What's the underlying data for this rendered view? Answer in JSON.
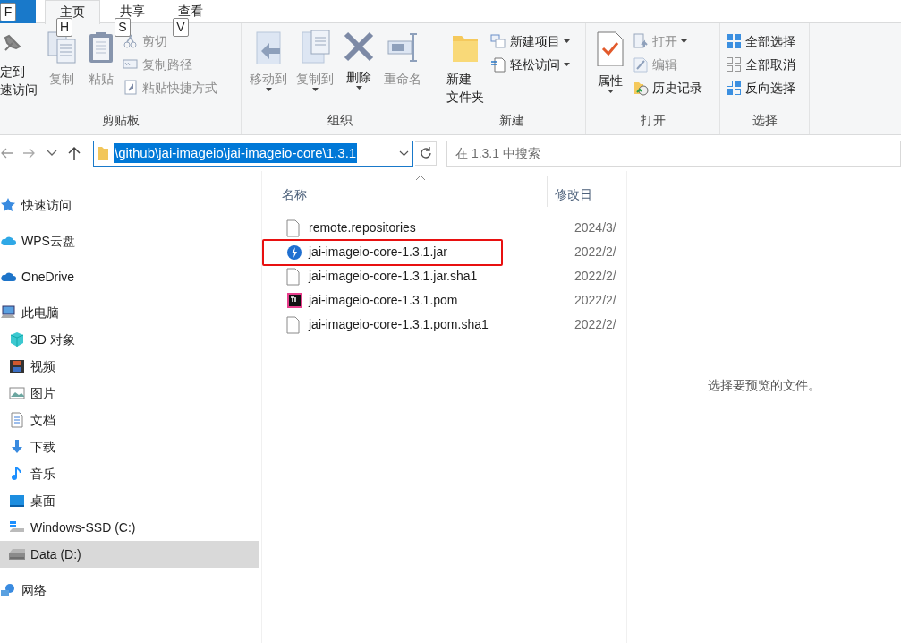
{
  "ribbon_tabs": [
    {
      "kind": "file",
      "keytip": "F",
      "selected": false
    },
    {
      "kind": "tab",
      "label": "主页",
      "keytip": "H",
      "selected": true
    },
    {
      "kind": "tab",
      "label": "共享",
      "keytip": "S",
      "selected": false
    },
    {
      "kind": "tab",
      "label": "查看",
      "keytip": "V",
      "selected": false
    }
  ],
  "ribbon_groups": [
    {
      "label": "剪贴板",
      "items": [
        {
          "kind": "large",
          "lines": [
            "定到",
            "速访问"
          ],
          "disabled": false,
          "dropdown": false
        },
        {
          "kind": "large",
          "lines": [
            "复制"
          ],
          "disabled": true,
          "dropdown": false
        },
        {
          "kind": "large",
          "lines": [
            "粘贴"
          ],
          "disabled": true,
          "dropdown": false
        },
        {
          "kind": "stack",
          "entries": [
            {
              "label": "剪切",
              "disabled": true,
              "dropdown": false
            },
            {
              "label": "复制路径",
              "disabled": true,
              "dropdown": false
            },
            {
              "label": "粘贴快捷方式",
              "disabled": true,
              "dropdown": false
            }
          ]
        }
      ]
    },
    {
      "label": "组织",
      "items": [
        {
          "kind": "large",
          "lines": [
            "移动到"
          ],
          "disabled": true,
          "dropdown": true
        },
        {
          "kind": "large",
          "lines": [
            "复制到"
          ],
          "disabled": true,
          "dropdown": true
        },
        {
          "kind": "large",
          "lines": [
            "删除"
          ],
          "disabled": false,
          "dropdown": true
        },
        {
          "kind": "large",
          "lines": [
            "重命名"
          ],
          "disabled": true,
          "dropdown": false
        }
      ]
    },
    {
      "label": "新建",
      "items": [
        {
          "kind": "large",
          "lines": [
            "新建",
            "文件夹"
          ],
          "disabled": false,
          "dropdown": false
        },
        {
          "kind": "stack",
          "entries": [
            {
              "label": "新建项目",
              "disabled": false,
              "dropdown": true
            },
            {
              "label": "轻松访问",
              "disabled": false,
              "dropdown": true
            }
          ]
        }
      ]
    },
    {
      "label": "打开",
      "items": [
        {
          "kind": "large",
          "lines": [
            "属性"
          ],
          "disabled": false,
          "dropdown": true
        },
        {
          "kind": "stack",
          "entries": [
            {
              "label": "打开",
              "disabled": true,
              "dropdown": true
            },
            {
              "label": "编辑",
              "disabled": true,
              "dropdown": false
            },
            {
              "label": "历史记录",
              "disabled": false,
              "dropdown": false
            }
          ]
        }
      ]
    },
    {
      "label": "选择",
      "items": [
        {
          "kind": "stack",
          "entries": [
            {
              "label": "全部选择",
              "disabled": false,
              "dropdown": false
            },
            {
              "label": "全部取消",
              "disabled": false,
              "dropdown": false
            },
            {
              "label": "反向选择",
              "disabled": false,
              "dropdown": false
            }
          ]
        }
      ]
    }
  ],
  "address_bar": {
    "path": "\\github\\jai-imageio\\jai-imageio-core\\1.3.1",
    "selected": true
  },
  "search": {
    "placeholder": "在 1.3.1 中搜索"
  },
  "navigation_pane": [
    {
      "label": "快速访问",
      "selected": false
    },
    {
      "label": "WPS云盘",
      "selected": false
    },
    {
      "label": "OneDrive",
      "selected": false
    },
    {
      "label": "此电脑",
      "selected": false,
      "children": [
        {
          "label": "3D 对象",
          "selected": false
        },
        {
          "label": "视频",
          "selected": false
        },
        {
          "label": "图片",
          "selected": false
        },
        {
          "label": "文档",
          "selected": false
        },
        {
          "label": "下载",
          "selected": false
        },
        {
          "label": "音乐",
          "selected": false
        },
        {
          "label": "桌面",
          "selected": false
        },
        {
          "label": "Windows-SSD (C:)",
          "selected": false
        },
        {
          "label": "Data (D:)",
          "selected": true
        }
      ]
    },
    {
      "label": "网络",
      "selected": false
    }
  ],
  "file_list": {
    "columns": [
      "名称",
      "修改日"
    ],
    "rows": [
      {
        "name": "remote.repositories",
        "date": "2024/3/",
        "highlighted": false
      },
      {
        "name": "jai-imageio-core-1.3.1.jar",
        "date": "2022/2/",
        "highlighted": true
      },
      {
        "name": "jai-imageio-core-1.3.1.jar.sha1",
        "date": "2022/2/",
        "highlighted": false
      },
      {
        "name": "jai-imageio-core-1.3.1.pom",
        "date": "2022/2/",
        "highlighted": false
      },
      {
        "name": "jai-imageio-core-1.3.1.pom.sha1",
        "date": "2022/2/",
        "highlighted": false
      }
    ]
  },
  "preview_pane": {
    "message": "选择要预览的文件。"
  }
}
